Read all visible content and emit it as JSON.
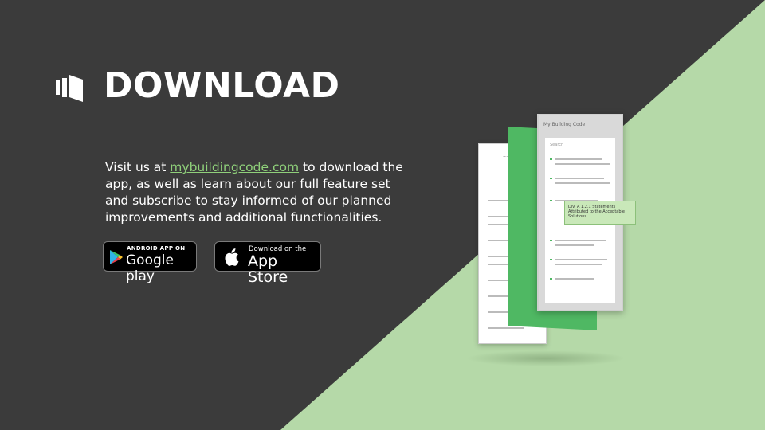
{
  "header": {
    "title": "DOWNLOAD"
  },
  "description": {
    "prefix": "Visit us at ",
    "link_text": "mybuildingcode.com",
    "suffix": " to download the app, as well as learn about our full feature set and subscribe to stay informed of our planned improvements and additional functionalities."
  },
  "badges": {
    "google": {
      "small": "ANDROID APP ON",
      "big": "Google play"
    },
    "apple": {
      "small": "Download on the",
      "big": "App Store"
    }
  },
  "mockup": {
    "front_header": "My Building Code",
    "search_placeholder": "Search",
    "popup_text": "Div. A 1.2.1 Statements Attributed to the Acceptable Solutions",
    "back_header": "1.1.2. App"
  },
  "colors": {
    "background_dark": "#3b3b3b",
    "background_green": "#b5d9a8",
    "accent_green": "#4fb863",
    "link": "#8fd07a"
  }
}
